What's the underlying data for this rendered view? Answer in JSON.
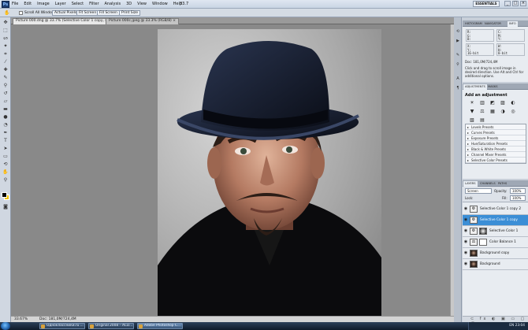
{
  "menu": {
    "logo": "Ps",
    "items": [
      "File",
      "Edit",
      "Image",
      "Layer",
      "Select",
      "Filter",
      "Analysis",
      "3D",
      "View",
      "Window",
      "Help"
    ],
    "zoom": "33.7",
    "workspace": "ESSENTIALS",
    "win_min": "_",
    "win_max": "□",
    "win_close": "×"
  },
  "options": {
    "scroll_all": "Scroll All Windows",
    "actual": "Actual Pixels",
    "fit": "Fit Screen",
    "fill": "Fill Screen",
    "print": "Print Size"
  },
  "tabs": [
    "Picture 000.dng @ 33.7% (Selective Color 1 copy, RGB/16*) ×",
    "Picture 000c.jpeg @ 33.3% (RGB/8) ×"
  ],
  "status": {
    "zoom": "33.67%",
    "doc": "Doc: 181,0M/724,4M"
  },
  "panels": {
    "top_tabs": [
      "HISTOGRAM",
      "NAVIGATOR",
      "INFO"
    ],
    "info": {
      "r": "R:",
      "g": "G:",
      "b": "B:",
      "bit1": "16-bit",
      "c": "C:",
      "m": "M:",
      "y": "Y:",
      "k": "K:",
      "bit2": "8-bit",
      "x": "X:",
      "yy": "Y:",
      "w": "W:",
      "h": "H:",
      "doc": "Doc: 181,0M/724,4M",
      "hint": "Click and drag to scroll image in desired direction.  Use Alt and Ctrl for additional options."
    },
    "adj_tabs": [
      "ADJUSTMENTS",
      "MASKS"
    ],
    "adj_title": "Add an adjustment",
    "adj_icons": [
      "☀",
      "▥",
      "◩",
      "▨",
      "◐",
      "▼",
      "⚖",
      "▦",
      "◑",
      "◎",
      "▧",
      "▤"
    ],
    "presets": [
      "Levels Presets",
      "Curves Presets",
      "Exposure Presets",
      "Hue/Saturation Presets",
      "Black & White Presets",
      "Channel Mixer Presets",
      "Selective Color Presets"
    ],
    "layer_tabs": [
      "LAYERS",
      "CHANNELS",
      "PATHS"
    ],
    "blend_mode": "Screen",
    "opacity_label": "Opacity:",
    "opacity": "100%",
    "lock_label": "Lock:",
    "fill_label": "Fill:",
    "fill": "100%",
    "layers": [
      {
        "name": "Selective Color 1 copy 2",
        "thumb": "adj",
        "active": false
      },
      {
        "name": "Selective Color 1 copy",
        "thumb": "adj",
        "active": true
      },
      {
        "name": "Selective Color 1",
        "thumb": "adj",
        "active": false
      },
      {
        "name": "Color Balance 1",
        "thumb": "adj",
        "active": false
      },
      {
        "name": "Background copy",
        "thumb": "photo",
        "active": false
      },
      {
        "name": "Background",
        "thumb": "photo",
        "active": false
      }
    ],
    "layer_foot": "⊂ fx ◐ ▣ ▭ ▢ 🗑"
  },
  "taskbar": {
    "tasks": [
      "Одноклассники.ru ...",
      "Original 2008 – ACD...",
      "Adobe Photoshop C..."
    ],
    "lang": "EN",
    "time": "23:04"
  }
}
